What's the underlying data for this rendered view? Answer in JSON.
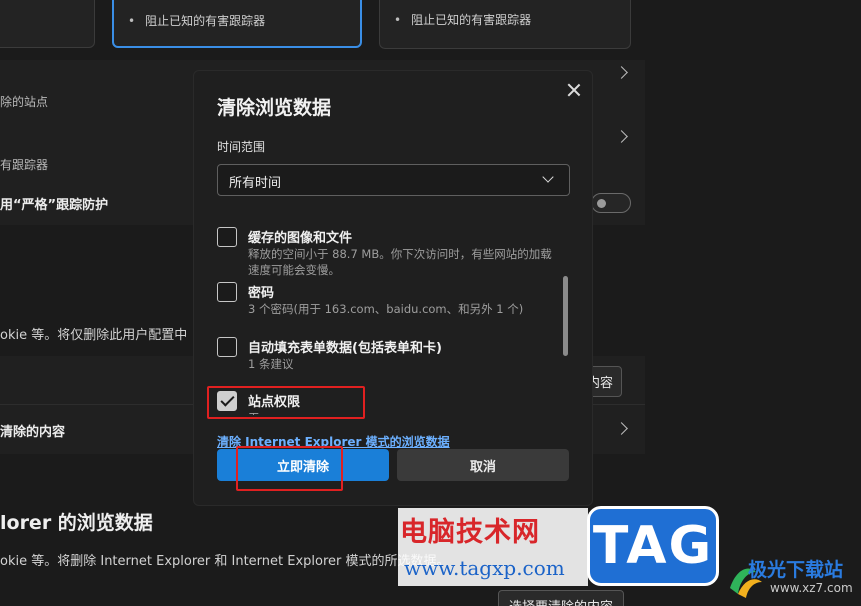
{
  "background": {
    "card_left_text": "阻止已知的有害跟踪器",
    "card_right_text": "阻止已知的有害跟踪器",
    "row1_text": "除的站点",
    "row2_text": "有跟踪器",
    "strict_text": "用“严格”跟踪防护",
    "cookie_text": "okie 等。将仅删除此用户配置中",
    "button_content": "内容",
    "clear_content_row": "清除的内容",
    "ie_section_title": "lorer 的浏览数据",
    "ie_section_desc": "okie 等。将删除 Internet Explorer 和 Internet Explorer 模式的所选数据。",
    "ie_bottom_button": "选择要清除的内容"
  },
  "dialog": {
    "title": "清除浏览数据",
    "time_range_label": "时间范围",
    "time_range_value": "所有时间",
    "options": [
      {
        "title": "缓存的图像和文件",
        "desc": "释放的空间小于 88.7 MB。你下次访问时，有些网站的加载速度可能会变慢。",
        "checked": false
      },
      {
        "title": "密码",
        "desc": "3 个密码(用于 163.com、baidu.com、和另外 1 个)",
        "checked": false
      },
      {
        "title": "自动填充表单数据(包括表单和卡)",
        "desc": "1 条建议",
        "checked": false
      },
      {
        "title": "站点权限",
        "desc": "无",
        "checked": true
      }
    ],
    "ie_link": "清除 Internet Explorer 模式的浏览数据",
    "clear_now": "立即清除",
    "cancel": "取消"
  },
  "watermarks": {
    "cn_site": "电脑技术网",
    "cn_url": "www.tagxp.com",
    "tag": "TAG",
    "jg_name": "极光下载站",
    "jg_url": "www.xz7.com"
  },
  "colors": {
    "accent": "#1a7fd8",
    "highlight": "#e02020",
    "link": "#6cb0ff"
  }
}
